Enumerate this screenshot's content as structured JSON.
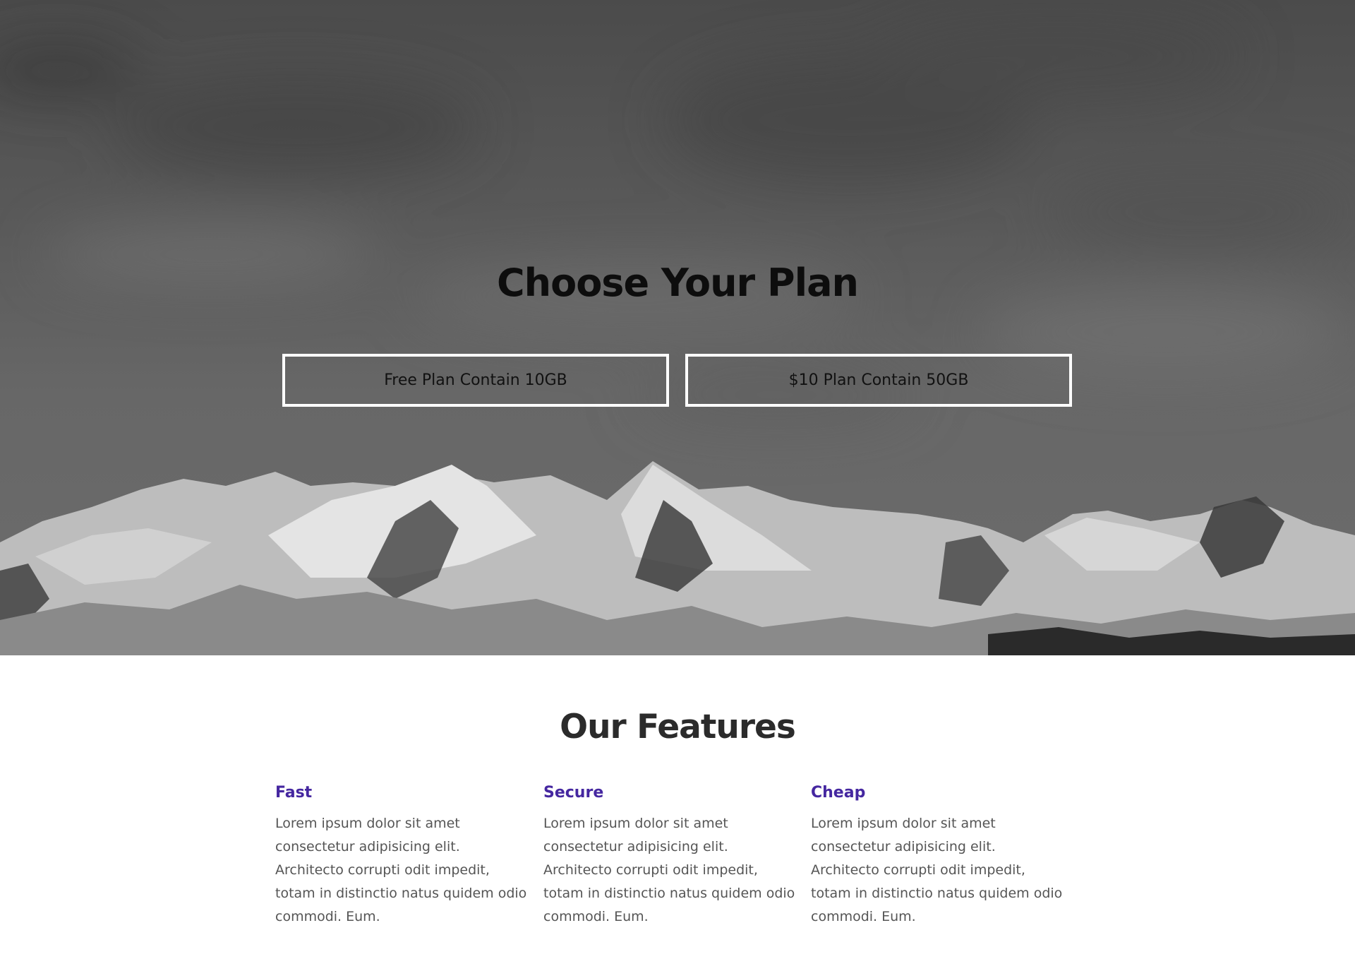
{
  "hero": {
    "title": "Choose Your Plan",
    "plans": [
      {
        "label": "Free Plan Contain 10GB"
      },
      {
        "label": "$10 Plan Contain 50GB"
      }
    ],
    "background_image": "grayscale-snowy-mountain-range-under-cloudy-sky"
  },
  "features": {
    "title": "Our Features",
    "items": [
      {
        "heading": "Fast",
        "text": "Lorem ipsum dolor sit amet consectetur adipisicing elit. Architecto corrupti odit impedit, totam in distinctio natus quidem odio commodi. Eum."
      },
      {
        "heading": "Secure",
        "text": "Lorem ipsum dolor sit amet consectetur adipisicing elit. Architecto corrupti odit impedit, totam in distinctio natus quidem odio commodi. Eum."
      },
      {
        "heading": "Cheap",
        "text": "Lorem ipsum dolor sit amet consectetur adipisicing elit. Architecto corrupti odit impedit, totam in distinctio natus quidem odio commodi. Eum."
      }
    ]
  },
  "colors": {
    "feature_heading": "#4527a0",
    "body_text": "#555555",
    "hero_title": "#0d0d0d",
    "features_title": "#2b2b2b",
    "plan_border": "#ffffff"
  }
}
